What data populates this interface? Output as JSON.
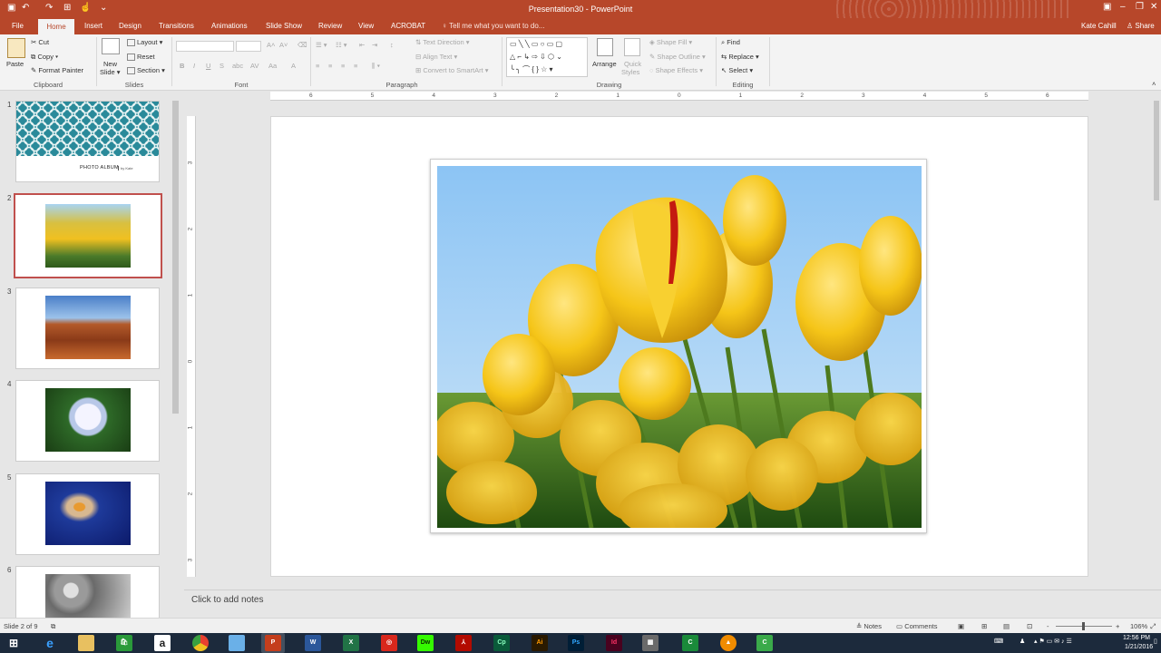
{
  "titlebar": {
    "document_title": "Presentation30 - PowerPoint",
    "user": "Kate Cahill",
    "share": "Share",
    "qat_icons": [
      "save-icon",
      "undo-icon",
      "redo-icon",
      "start-from-beginning-icon",
      "customize-qat-icon"
    ]
  },
  "tabs": [
    "File",
    "Home",
    "Insert",
    "Design",
    "Transitions",
    "Animations",
    "Slide Show",
    "Review",
    "View",
    "ACROBAT"
  ],
  "tell_me": "Tell me what you want to do...",
  "ribbon": {
    "clipboard": {
      "paste": "Paste",
      "cut": "Cut",
      "copy": "Copy",
      "format_painter": "Format Painter",
      "label": "Clipboard"
    },
    "slides": {
      "new_slide_1": "New",
      "new_slide_2": "Slide",
      "layout": "Layout",
      "reset": "Reset",
      "section": "Section",
      "label": "Slides"
    },
    "font": {
      "label": "Font",
      "bold": "B",
      "italic": "I",
      "underline": "U",
      "strike": "S",
      "font_color": "A"
    },
    "paragraph": {
      "text_direction": "Text Direction",
      "align_text": "Align Text",
      "smartart": "Convert to SmartArt",
      "label": "Paragraph"
    },
    "drawing": {
      "arrange": "Arrange",
      "quick_styles_1": "Quick",
      "quick_styles_2": "Styles",
      "shape_fill": "Shape Fill",
      "shape_outline": "Shape Outline",
      "shape_effects": "Shape Effects",
      "label": "Drawing"
    },
    "editing": {
      "find": "Find",
      "replace": "Replace",
      "select": "Select",
      "label": "Editing"
    }
  },
  "rulers": {
    "horizontal": [
      "6",
      "5",
      "4",
      "3",
      "2",
      "1",
      "0",
      "1",
      "2",
      "3",
      "4",
      "5",
      "6"
    ],
    "vertical": [
      "3",
      "2",
      "1",
      "0",
      "1",
      "2",
      "3"
    ]
  },
  "thumbnails": [
    {
      "number": "1",
      "caption": "PHOTO ALBUM",
      "byline": "by Kate"
    },
    {
      "number": "2"
    },
    {
      "number": "3"
    },
    {
      "number": "4"
    },
    {
      "number": "5"
    },
    {
      "number": "6"
    }
  ],
  "notes_placeholder": "Click to add notes",
  "status": {
    "slide_info": "Slide 2 of 9",
    "notes": "Notes",
    "comments": "Comments",
    "zoom": "106%",
    "minus": "-",
    "plus": "+"
  },
  "taskbar": {
    "apps": [
      "start",
      "edge",
      "explorer",
      "store",
      "amazon",
      "chrome",
      "notes",
      "powerpoint",
      "word",
      "excel",
      "creative-cloud",
      "dreamweaver",
      "acrobat",
      "captivate",
      "illustrator",
      "photoshop",
      "indesign",
      "calculator",
      "camtasia",
      "vlc",
      "camtasia-recorder"
    ],
    "time": "12:56 PM",
    "date": "1/21/2016"
  },
  "colors": {
    "accent": "#b7472a",
    "selected_thumb": "#c0504d",
    "taskbar": "#1c2a3c"
  }
}
